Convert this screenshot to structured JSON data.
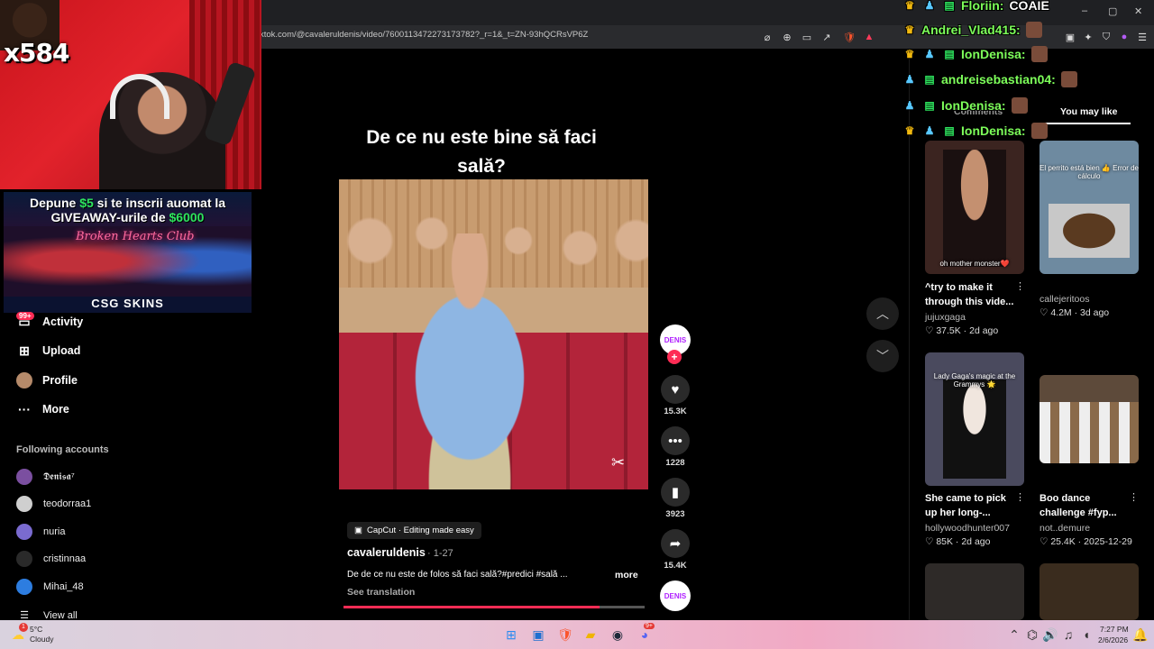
{
  "browser": {
    "url": "ktok.com/@cavaleruldenis/video/7600113472273173782?_r=1&_t=ZN-93hQCRsVP6Z",
    "window_controls": [
      "–",
      "▢",
      "✕"
    ]
  },
  "stream_overlay": {
    "counter": "x584",
    "promo": {
      "line1_prefix": "Depune",
      "line1_amount": "$5",
      "line1_suffix": "si te inscrii auomat la",
      "line2_prefix": "GIVEAWAY-urile de",
      "line2_amount": "$6000",
      "scene_sign": "Broken Hearts Club",
      "brand": "CSG SKINS"
    }
  },
  "sidebar": {
    "badge": "99+",
    "items": [
      {
        "label": "Activity",
        "icon": "activity-icon"
      },
      {
        "label": "Upload",
        "icon": "upload-icon"
      },
      {
        "label": "Profile",
        "icon": "profile-avatar"
      },
      {
        "label": "More",
        "icon": "more-icon"
      }
    ],
    "following_title": "Following accounts",
    "following": [
      {
        "name": "𝕯𝖊𝖓𝖎𝖘𝖆⁷",
        "color": "#7b4fa0"
      },
      {
        "name": "teodorraa1",
        "color": "#cfcfcf"
      },
      {
        "name": "nuria",
        "color": "#7a6bd0"
      },
      {
        "name": "cristinnaa",
        "color": "#2a2a2a"
      },
      {
        "name": "Mihai_48",
        "color": "#2d7de0"
      }
    ],
    "view_all": "View all"
  },
  "video": {
    "caption_line1": "De ce nu este bine să faci",
    "caption_line2": "sală?",
    "capcut_tag": "CapCut · Editing made easy",
    "author": "cavaleruldenis",
    "date": "· 1-27",
    "description": "De de ce nu este de folos să faci sală?#predici #sală ...",
    "more_label": "more",
    "see_translation": "See translation",
    "progress": 0.85
  },
  "actions": {
    "avatar_label": "DENIS",
    "likes": "15.3K",
    "comments": "1228",
    "saves": "3923",
    "shares": "15.4K"
  },
  "right_panel": {
    "tabs": [
      "Comments",
      "You may like"
    ],
    "cards": [
      {
        "title": "^try to make it through this vide...",
        "author": "jujuxgaga",
        "stats": "♡ 37.5K · 2d ago",
        "thumb_caption": "oh mother monster❤️",
        "bg": "#3b2420"
      },
      {
        "title": "",
        "author": "callejeritoos",
        "stats": "♡ 4.2M · 3d ago",
        "thumb_caption": "El perrito está bien 👍 Error de cálculo",
        "bg": "#6e8aa0"
      },
      {
        "title": "She came to pick up her long-...",
        "author": "hollywoodhunter007",
        "stats": "♡ 85K · 2d ago",
        "thumb_caption": "Lady Gaga's magic at the Grammys 🌟",
        "bg": "#4a4a5e"
      },
      {
        "title": "Boo dance challenge #fyp...",
        "author": "not..demure",
        "stats": "♡ 25.4K · 2025-12-29",
        "thumb_caption": "",
        "bg": "#5d4a3a"
      }
    ]
  },
  "chat": [
    {
      "name": "Floriin:",
      "message": "COAIE",
      "badges": [
        "crown",
        "bot",
        "gift"
      ]
    },
    {
      "name": "Andrei_Vlad415:",
      "message": "",
      "badges": [
        "crown"
      ]
    },
    {
      "name": "IonDenisa:",
      "message": "",
      "badges": [
        "crown",
        "bot",
        "gift"
      ]
    },
    {
      "name": "andreisebastian04:",
      "message": "",
      "badges": [
        "bot",
        "gift"
      ]
    },
    {
      "name": "IonDenisa:",
      "message": "",
      "badges": [
        "bot",
        "gift"
      ]
    },
    {
      "name": "IonDenisa:",
      "message": "",
      "badges": [
        "crown",
        "bot",
        "gift"
      ]
    }
  ],
  "taskbar": {
    "weather_badge": "1",
    "weather_temp": "5°C",
    "weather_desc": "Cloudy",
    "discord_badge": "9+",
    "time": "7:27 PM",
    "date": "2/6/2026"
  }
}
